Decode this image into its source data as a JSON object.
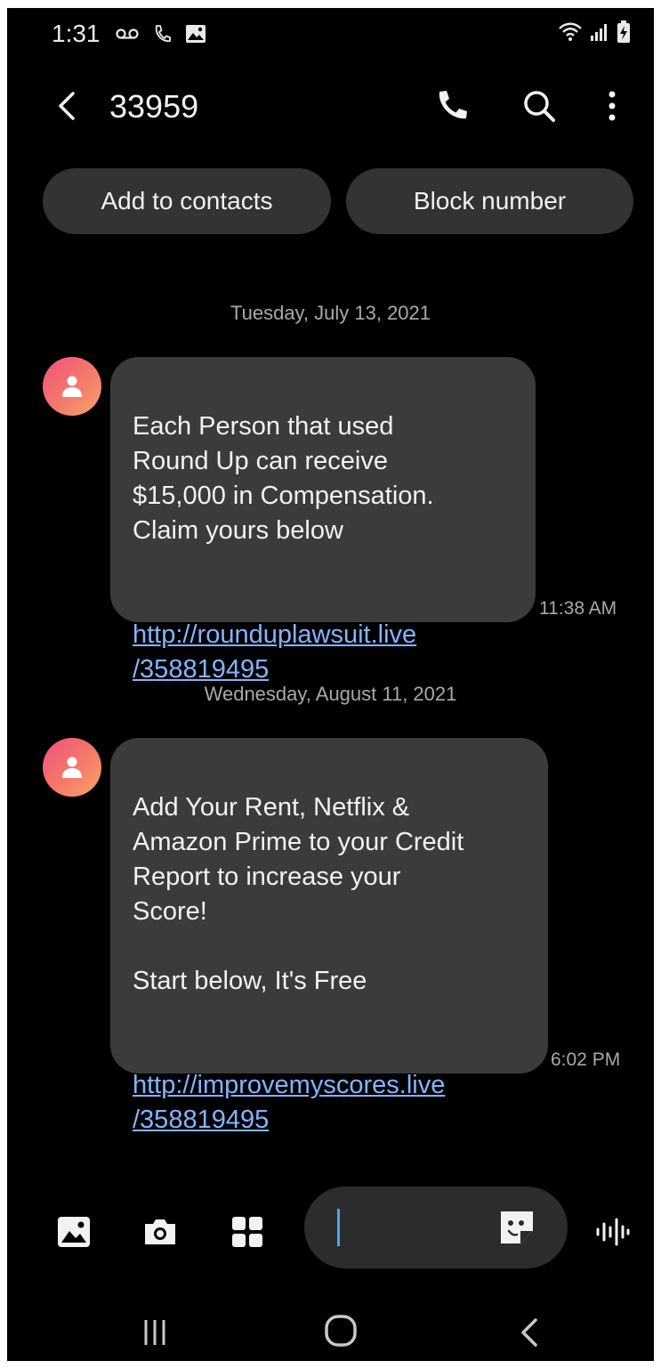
{
  "status_bar": {
    "time": "1:31",
    "left_icons": [
      "voicemail-icon",
      "wifi-calling-icon",
      "gallery-icon"
    ],
    "right_icons": [
      "wifi-icon",
      "signal-icon",
      "battery-charging-icon"
    ]
  },
  "header": {
    "title": "33959",
    "actions": [
      "back-icon",
      "phone-icon",
      "search-icon",
      "more-icon"
    ]
  },
  "chips": {
    "add_contact": "Add to contacts",
    "block": "Block number"
  },
  "conversation": [
    {
      "date": "Tuesday, July 13, 2021",
      "text": "Each Person that used\nRound Up can receive\n$15,000 in Compensation.\nClaim yours below",
      "link": "http://rounduplawsuit.live\n/358819495",
      "time": "11:38 AM"
    },
    {
      "date": "Wednesday, August 11, 2021",
      "text": "Add Your Rent, Netflix &\nAmazon Prime to your Credit\nReport to increase your\nScore!\n\nStart below, It's Free",
      "link": "http://improvemyscores.live\n/358819495",
      "time": "6:02 PM"
    }
  ],
  "composer": {
    "tools": [
      "image-icon",
      "camera-icon",
      "apps-icon"
    ],
    "value": "",
    "right_icons": [
      "sticker-icon",
      "voice-icon"
    ]
  },
  "nav": [
    "recents-icon",
    "home-icon",
    "back-icon"
  ],
  "colors": {
    "background": "#000000",
    "bubble": "#3b3b3b",
    "link": "#84b4ff",
    "cursor": "#3fa9f5",
    "avatar_gradient": [
      "#f0507a",
      "#f9a56a"
    ]
  }
}
